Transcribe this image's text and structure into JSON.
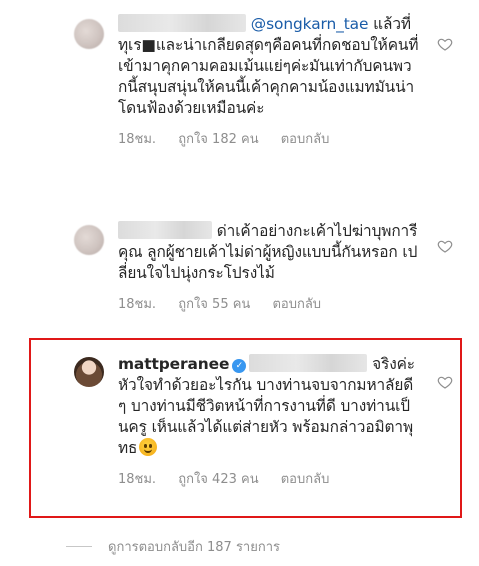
{
  "comments": [
    {
      "mention": "@songkarn_tae",
      "text": " แล้วที่ทุเร■และน่าเกลียดสุดๆคือคนที่กดชอบให้คนที่เข้ามาคุกคามคอมเม้นแย่ๆค่ะมันเท่ากับคนพวกนี้สนุบสนุ่นให้คนนี้เค้าคุกคามน้องแมทมันน่าโดนฟ้องด้วยเหมือนค่ะ",
      "time": "18ชม.",
      "likes": "ถูกใจ 182 คน",
      "reply": "ตอบกลับ"
    },
    {
      "text": " ด่าเค้าอย่างกะเค้าไปฆ่าบุพการีคุณ ลูกผู้ชายเค้าไม่ด่าผู้หญิงแบบนี้กันหรอก เปลี่ยนใจไปนุ่งกระโปรงไม้",
      "time": "18ชม.",
      "likes": "ถูกใจ 55 คน",
      "reply": "ตอบกลับ"
    },
    {
      "username": "mattperanee",
      "text": " จริงค่ะ หัวใจทำด้วยอะไรกัน บางท่านจบจากมหาลัยดีๆ บางท่านมีชีวิตหน้าที่การงานที่ดี บางท่านเป็นครู เห็นแล้วได้แต่ส่ายหัว พร้อมกล่าวอมิตาพุทธ",
      "time": "18ชม.",
      "likes": "ถูกใจ 423 คน",
      "reply": "ตอบกลับ"
    }
  ],
  "more_replies": "ดูการตอบกลับอีก 187 รายการ",
  "icons": {
    "heart": "heart-outline-icon",
    "verified": "verified-badge-icon",
    "emoji": "upside-down-face-emoji"
  },
  "colors": {
    "highlight_border": "#e01818",
    "mention": "#1a5ca8",
    "meta": "#8e8e8e",
    "verified": "#3897f0"
  }
}
